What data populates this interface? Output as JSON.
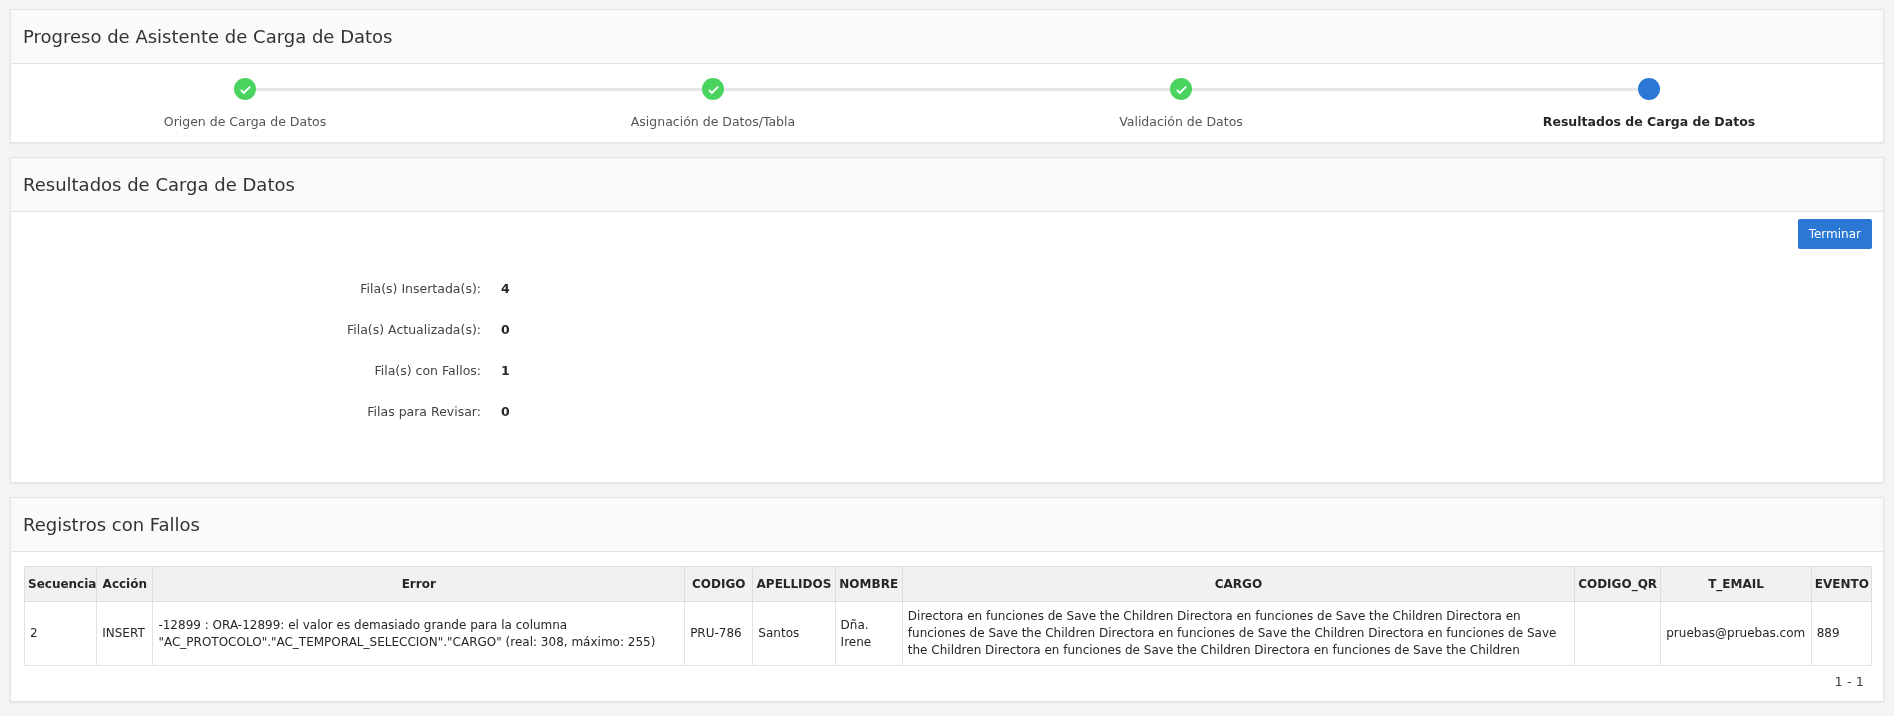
{
  "progress": {
    "title": "Progreso de Asistente de Carga de Datos",
    "steps": [
      {
        "label": "Origen de Carga de Datos",
        "completed": true,
        "selected": false
      },
      {
        "label": "Asignación de Datos/Tabla",
        "completed": true,
        "selected": false
      },
      {
        "label": "Validación de Datos",
        "completed": true,
        "selected": false
      },
      {
        "label": "Resultados de Carga de Datos",
        "completed": false,
        "selected": true
      }
    ]
  },
  "results": {
    "title": "Resultados de Carga de Datos",
    "button": "Terminar",
    "stats": [
      {
        "label": "Fila(s) Insertada(s):",
        "value": "4"
      },
      {
        "label": "Fila(s) Actualizada(s):",
        "value": "0"
      },
      {
        "label": "Fila(s) con Fallos:",
        "value": "1"
      },
      {
        "label": "Filas para Revisar:",
        "value": "0"
      }
    ]
  },
  "failures": {
    "title": "Registros con Fallos",
    "table": {
      "columns": [
        "Secuencia",
        "Acción",
        "Error",
        "CODIGO",
        "APELLIDOS",
        "NOMBRE",
        "CARGO",
        "CODIGO_QR",
        "T_EMAIL",
        "EVENTO"
      ],
      "rows": [
        [
          "2",
          "INSERT",
          "-12899 : ORA-12899: el valor es demasiado grande para la columna \"AC_PROTOCOLO\".\"AC_TEMPORAL_SELECCION\".\"CARGO\" (real: 308, máximo: 255)",
          "PRU-786",
          "Santos",
          "Dña. Irene",
          "Directora en funciones de Save the Children Directora en funciones de Save the Children Directora en funciones de Save the Children Directora en funciones de Save the Children Directora en funciones de Save the Children Directora en funciones de Save the Children Directora en funciones de Save the Children",
          "",
          "pruebas@pruebas.com",
          "889"
        ]
      ]
    },
    "pagination": "1 - 1"
  }
}
